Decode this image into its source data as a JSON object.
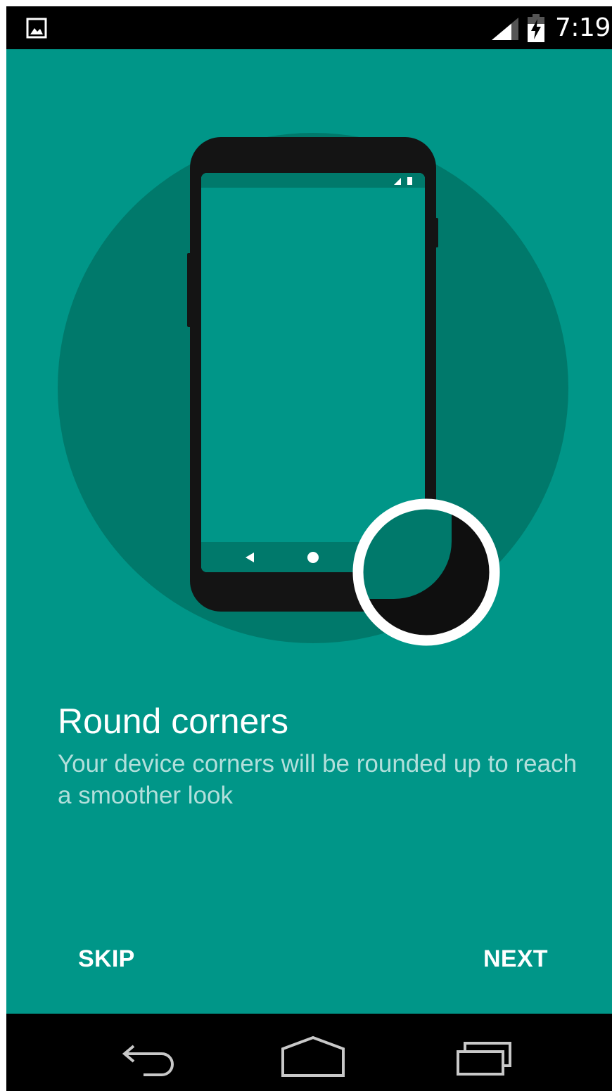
{
  "status_bar": {
    "time": "7:19",
    "notification_icon": "image-icon",
    "signal_icon": "signal-icon",
    "battery_icon": "battery-charging-icon"
  },
  "onboarding": {
    "illustration": "phone-round-corner-illustration",
    "title": "Round corners",
    "description": "Your device corners will be rounded up to reach a smoother look",
    "skip_label": "SKIP",
    "next_label": "NEXT"
  },
  "navigation_bar": {
    "back_icon": "back-icon",
    "home_icon": "home-icon",
    "recents_icon": "recents-icon"
  },
  "colors": {
    "background": "#009688",
    "circle": "#00796b",
    "phone_body": "#141414",
    "subtitle_text": "#b2dfdb",
    "ring": "#ffffff"
  }
}
